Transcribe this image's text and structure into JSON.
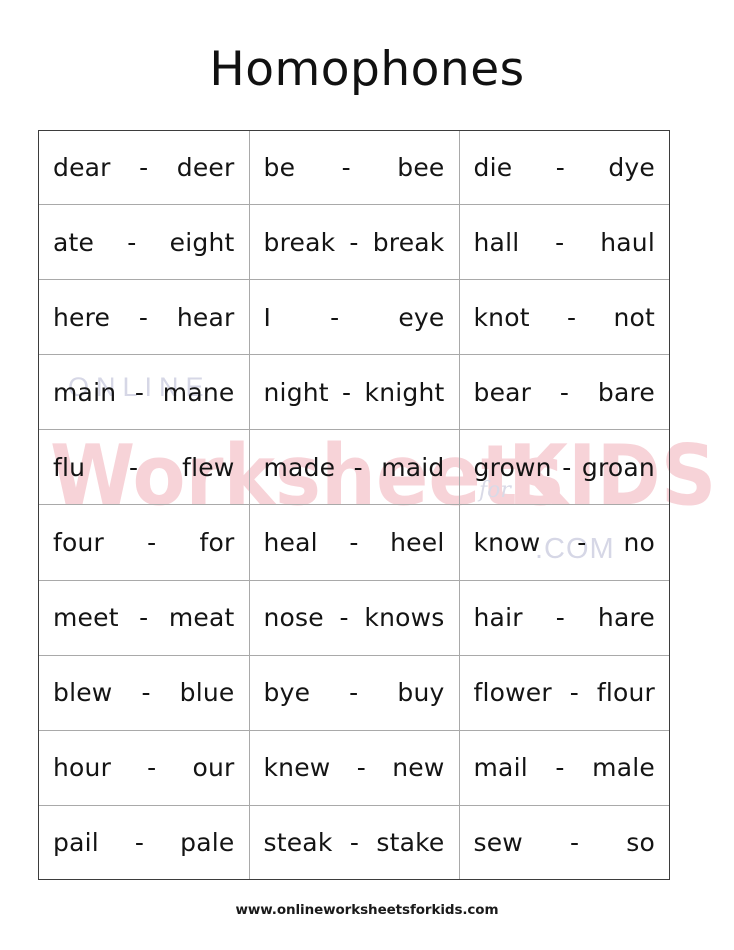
{
  "document": {
    "title": "Homophones",
    "background_color": "#ffffff",
    "text_color": "#141414"
  },
  "watermark": {
    "online": "ONLINE",
    "worksheets": "Worksheets",
    "for": "for",
    "kids": "KIDS",
    "dotcom": ".COM",
    "pink_color": "#f7d3d8",
    "grey_color": "#d6d7e6"
  },
  "table": {
    "columns": 3,
    "rows": 10,
    "separator": "-",
    "border_color": "#3d3d3d",
    "grid_color": "#a9a9a9",
    "cells": [
      [
        {
          "left": "dear",
          "right": "deer"
        },
        {
          "left": "be",
          "right": "bee"
        },
        {
          "left": "die",
          "right": "dye"
        }
      ],
      [
        {
          "left": "ate",
          "right": "eight"
        },
        {
          "left": "break",
          "right": "break"
        },
        {
          "left": "hall",
          "right": "haul"
        }
      ],
      [
        {
          "left": "here",
          "right": "hear"
        },
        {
          "left": "I",
          "right": "eye"
        },
        {
          "left": "knot",
          "right": "not"
        }
      ],
      [
        {
          "left": "main",
          "right": "mane"
        },
        {
          "left": "night",
          "right": "knight"
        },
        {
          "left": "bear",
          "right": "bare"
        }
      ],
      [
        {
          "left": "flu",
          "right": "flew"
        },
        {
          "left": "made",
          "right": "maid"
        },
        {
          "left": "grown",
          "right": "groan"
        }
      ],
      [
        {
          "left": "four",
          "right": "for"
        },
        {
          "left": "heal",
          "right": "heel"
        },
        {
          "left": "know",
          "right": "no"
        }
      ],
      [
        {
          "left": "meet",
          "right": "meat"
        },
        {
          "left": "nose",
          "right": "knows"
        },
        {
          "left": "hair",
          "right": "hare"
        }
      ],
      [
        {
          "left": "blew",
          "right": "blue"
        },
        {
          "left": "bye",
          "right": "buy"
        },
        {
          "left": "flower",
          "right": "flour"
        }
      ],
      [
        {
          "left": "hour",
          "right": "our"
        },
        {
          "left": "knew",
          "right": "new"
        },
        {
          "left": "mail",
          "right": "male"
        }
      ],
      [
        {
          "left": "pail",
          "right": "pale"
        },
        {
          "left": "steak",
          "right": "stake"
        },
        {
          "left": "sew",
          "right": "so"
        }
      ]
    ]
  },
  "footer": {
    "url": "www.onlineworksheetsforkids.com"
  }
}
